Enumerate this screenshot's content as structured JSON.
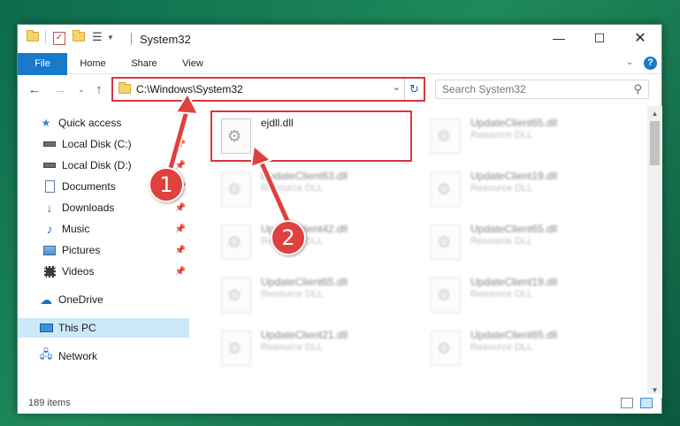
{
  "window": {
    "title": "System32"
  },
  "ribbon": {
    "tabs": [
      "File",
      "Home",
      "Share",
      "View"
    ]
  },
  "address": {
    "path": "C:\\Windows\\System32"
  },
  "search": {
    "placeholder": "Search System32"
  },
  "nav_pane": {
    "items": [
      {
        "label": "Quick access",
        "icon": "star-icon",
        "pinned": false
      },
      {
        "label": "Local Disk (C:)",
        "icon": "drive-icon",
        "pinned": true
      },
      {
        "label": "Local Disk (D:)",
        "icon": "drive-icon",
        "pinned": true
      },
      {
        "label": "Documents",
        "icon": "documents-icon",
        "pinned": true
      },
      {
        "label": "Downloads",
        "icon": "downloads-icon",
        "pinned": true
      },
      {
        "label": "Music",
        "icon": "music-icon",
        "pinned": true
      },
      {
        "label": "Pictures",
        "icon": "pictures-icon",
        "pinned": true
      },
      {
        "label": "Videos",
        "icon": "videos-icon",
        "pinned": true
      },
      {
        "label": "OneDrive",
        "icon": "onedrive-icon",
        "pinned": false
      },
      {
        "label": "This PC",
        "icon": "pc-icon",
        "pinned": false,
        "selected": true
      },
      {
        "label": "Network",
        "icon": "network-icon",
        "pinned": false
      }
    ]
  },
  "files": [
    {
      "name": "ejdll.dll",
      "type": ""
    },
    {
      "name": "UpdateClient65.dll",
      "type": "Resource DLL"
    },
    {
      "name": "UpdateClient63.dll",
      "type": "Resource DLL"
    },
    {
      "name": "UpdateClient19.dll",
      "type": "Resource DLL"
    },
    {
      "name": "UpdateClient42.dll",
      "type": "Resource DLL"
    },
    {
      "name": "UpdateClient65.dll",
      "type": "Resource DLL"
    },
    {
      "name": "UpdateClient65.dll",
      "type": "Resource DLL"
    },
    {
      "name": "UpdateClient19.dll",
      "type": "Resource DLL"
    },
    {
      "name": "UpdateClient21.dll",
      "type": "Resource DLL"
    },
    {
      "name": "UpdateClient65.dll",
      "type": "Resource DLL"
    }
  ],
  "status": {
    "count": "189 items"
  },
  "callouts": {
    "one": "1",
    "two": "2"
  },
  "colors": {
    "accent": "#1979ca",
    "highlight": "#d7373f",
    "callout": "#e0403e"
  }
}
